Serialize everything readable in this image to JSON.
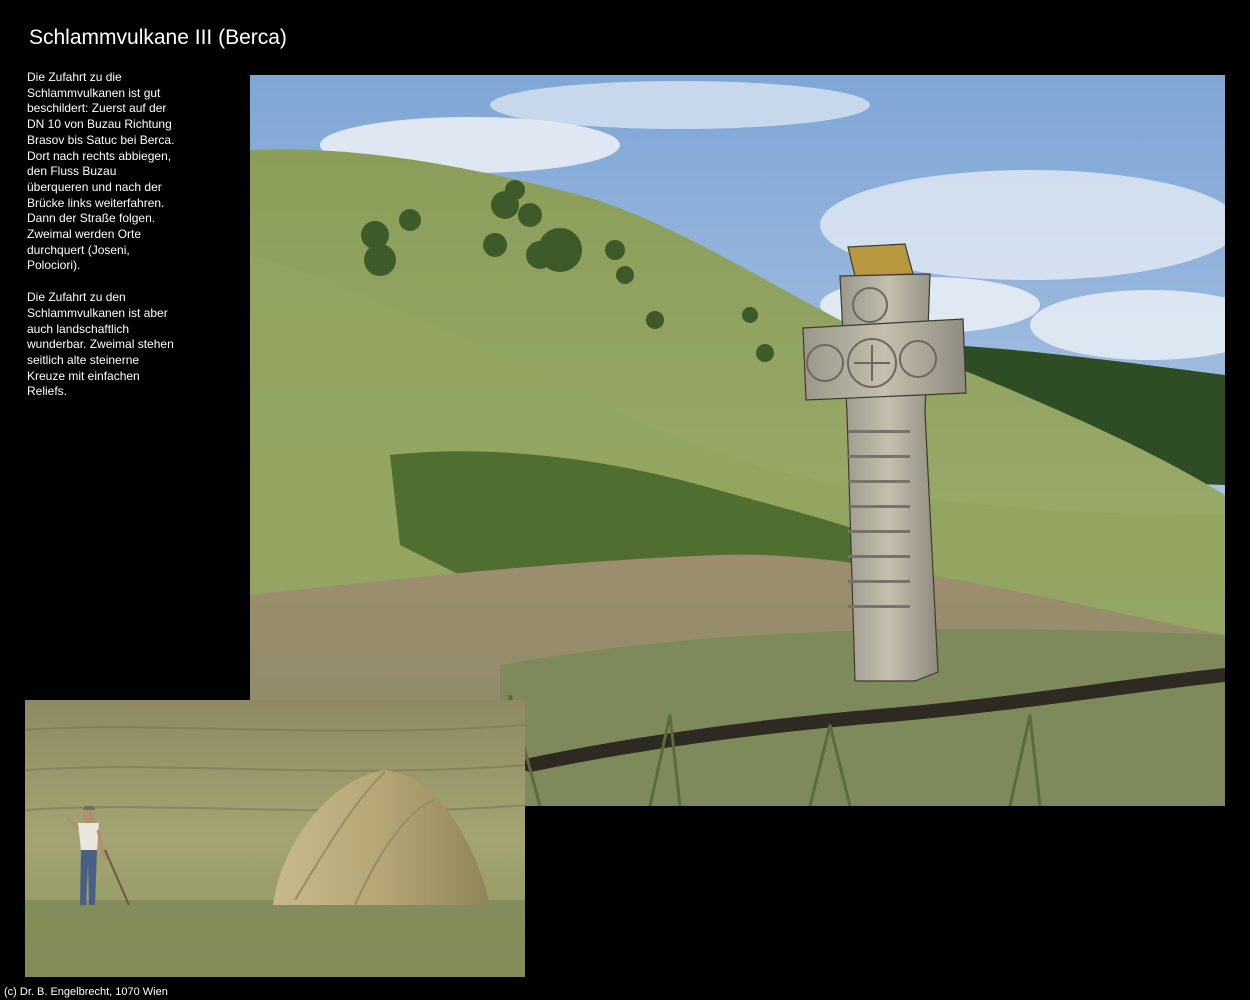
{
  "page": {
    "title": "Schlammvulkane III (Berca)",
    "description": [
      "Die Zufahrt zu die Schlammvulkanen ist gut beschildert: Zuerst auf der DN 10 von Buzau Richtung Brasov bis Satuc bei Berca. Dort nach rechts abbiegen, den Fluss Buzau überqueren und nach der Brücke links weiterfahren. Dann der Straße folgen. Zweimal werden Orte durchquert (Joseni, Polociori).",
      "Die Zufahrt zu den Schlammvulkanen ist aber auch landschaftlich wunderbar. Zweimal stehen seitlich alte steinerne Kreuze mit einfachen Reliefs."
    ],
    "copyright": "(c) Dr. B. Engelbrecht, 1070 Wien"
  },
  "colors": {
    "background": "#000000",
    "text": "#ffffff"
  }
}
